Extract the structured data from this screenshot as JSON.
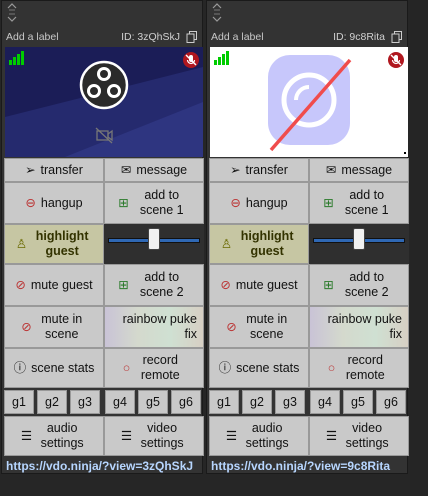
{
  "colors": {
    "background": "#262626",
    "card": "#333333",
    "button": "#c9c9c9",
    "highlight_button": "#c6c6a3",
    "link": "#b7d6ff",
    "slider": "#2f68b4",
    "muted_badge": "#b0171f"
  },
  "guests": [
    {
      "add_label": "Add a label",
      "id_text": "ID: 3zQhSkJ",
      "preview": "obs-logo",
      "video_muted": true,
      "audio_muted": true,
      "volume": 0.5,
      "buttons": {
        "transfer": "transfer",
        "message": "message",
        "hangup": "hangup",
        "add_scene_1": "add to scene 1",
        "highlight": "highlight guest",
        "mute_guest": "mute guest",
        "add_scene_2": "add to scene 2",
        "mute_in_scene": "mute in scene",
        "rainbow": "rainbow puke fix",
        "scene_stats": "scene stats",
        "record": "record remote",
        "groups": [
          "g1",
          "g2",
          "g3",
          "g4",
          "g5",
          "g6"
        ],
        "audio": "audio settings",
        "video": "video settings"
      },
      "link": "https://vdo.ninja/?view=3zQhSkJ"
    },
    {
      "add_label": "Add a label",
      "id_text": "ID: 9c8Rita",
      "preview": "camera-off",
      "video_muted": false,
      "audio_muted": true,
      "volume": 0.5,
      "buttons": {
        "transfer": "transfer",
        "message": "message",
        "hangup": "hangup",
        "add_scene_1": "add to scene 1",
        "highlight": "highlight guest",
        "mute_guest": "mute guest",
        "add_scene_2": "add to scene 2",
        "mute_in_scene": "mute in scene",
        "rainbow": "rainbow puke fix",
        "scene_stats": "scene stats",
        "record": "record remote",
        "groups": [
          "g1",
          "g2",
          "g3",
          "g4",
          "g5",
          "g6"
        ],
        "audio": "audio settings",
        "video": "video settings"
      },
      "link": "https://vdo.ninja/?view=9c8Rita"
    }
  ]
}
